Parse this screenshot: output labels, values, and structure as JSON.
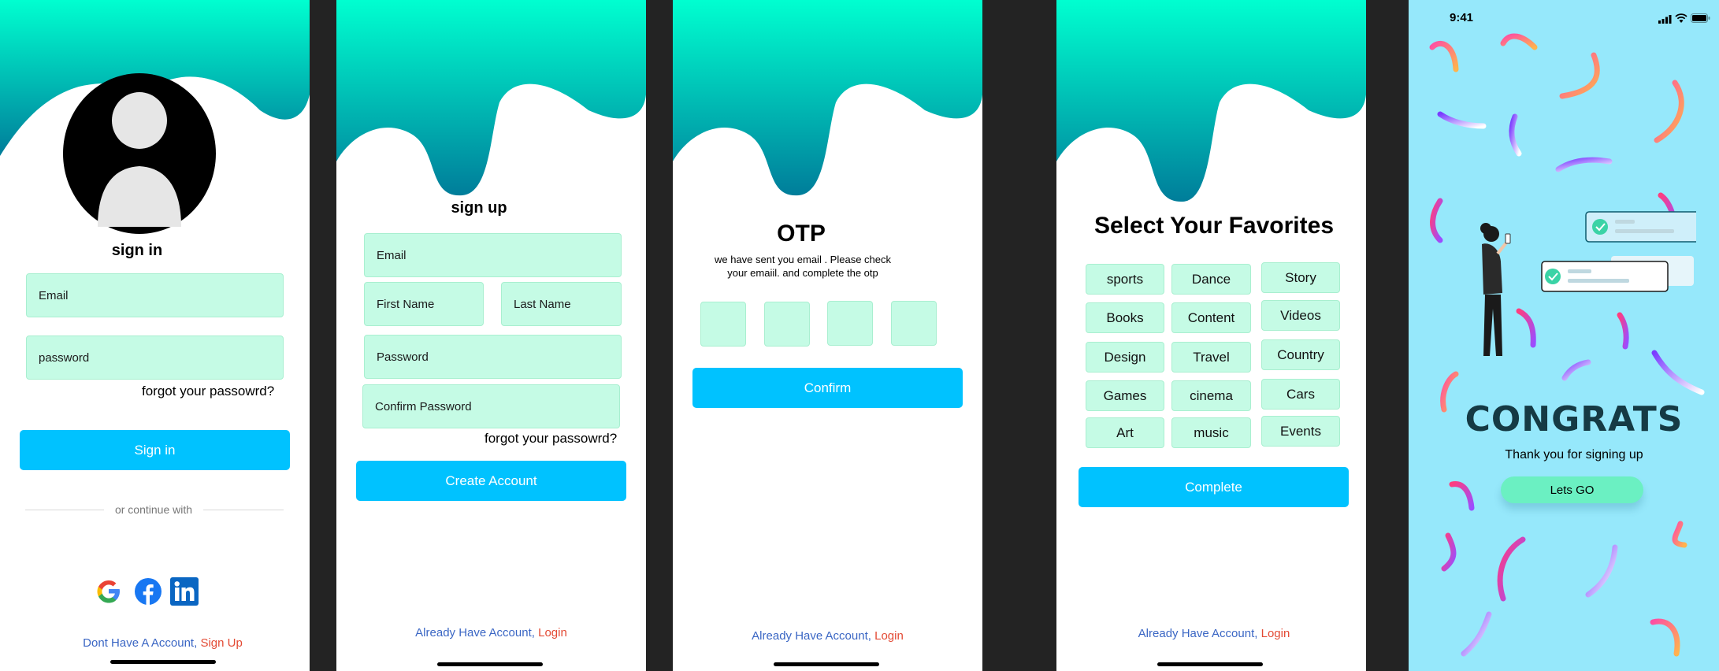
{
  "signin": {
    "title": "sign in",
    "email_placeholder": "Email",
    "password_placeholder": "password",
    "forgot": "forgot your passowrd?",
    "signin_button": "Sign in",
    "or_continue": "or continue with",
    "footer_question": "Dont Have A Account,",
    "footer_link": "Sign Up"
  },
  "signup": {
    "title": "sign up",
    "email_placeholder": "Email",
    "first_name_placeholder": "First Name",
    "last_name_placeholder": "Last Name",
    "password_placeholder": "Password",
    "confirm_password_placeholder": "Confirm Password",
    "forgot": "forgot your passowrd?",
    "create_button": "Create Account",
    "footer_question": "Already Have Account,",
    "footer_link": "Login"
  },
  "otp": {
    "title": "OTP",
    "message_line1": "we have sent you email . Please check",
    "message_line2": "your emaiil. and complete the otp",
    "confirm_button": "Confirm",
    "footer_question": "Already Have Account,",
    "footer_link": "Login"
  },
  "favorites": {
    "title": "Select Your Favorites",
    "chips": [
      "sports",
      "Dance",
      "Story",
      "Books",
      "Content",
      "Videos",
      "Design",
      "Travel",
      "Country",
      "Games",
      "cinema",
      "Cars",
      "Art",
      "music",
      "Events"
    ],
    "complete_button": "Complete",
    "footer_question": "Already Have Account,",
    "footer_link": "Login"
  },
  "congrats": {
    "status_time": "9:41",
    "title": "CONGRATS",
    "subtitle": "Thank you for signing up",
    "button": "Lets GO"
  },
  "colors": {
    "accent": "#00c2ff",
    "field_bg": "#c5fbe5",
    "wave_top": "#00ffd0",
    "wave_bottom": "#007d9a",
    "link_red": "#e34a34",
    "link_blue": "#3a66c4",
    "congrats_bg": "#96e8fb"
  },
  "icons": [
    "user-avatar-icon",
    "google-icon",
    "facebook-icon",
    "linkedin-icon",
    "check-icon",
    "signal-icon",
    "wifi-icon",
    "battery-icon"
  ]
}
